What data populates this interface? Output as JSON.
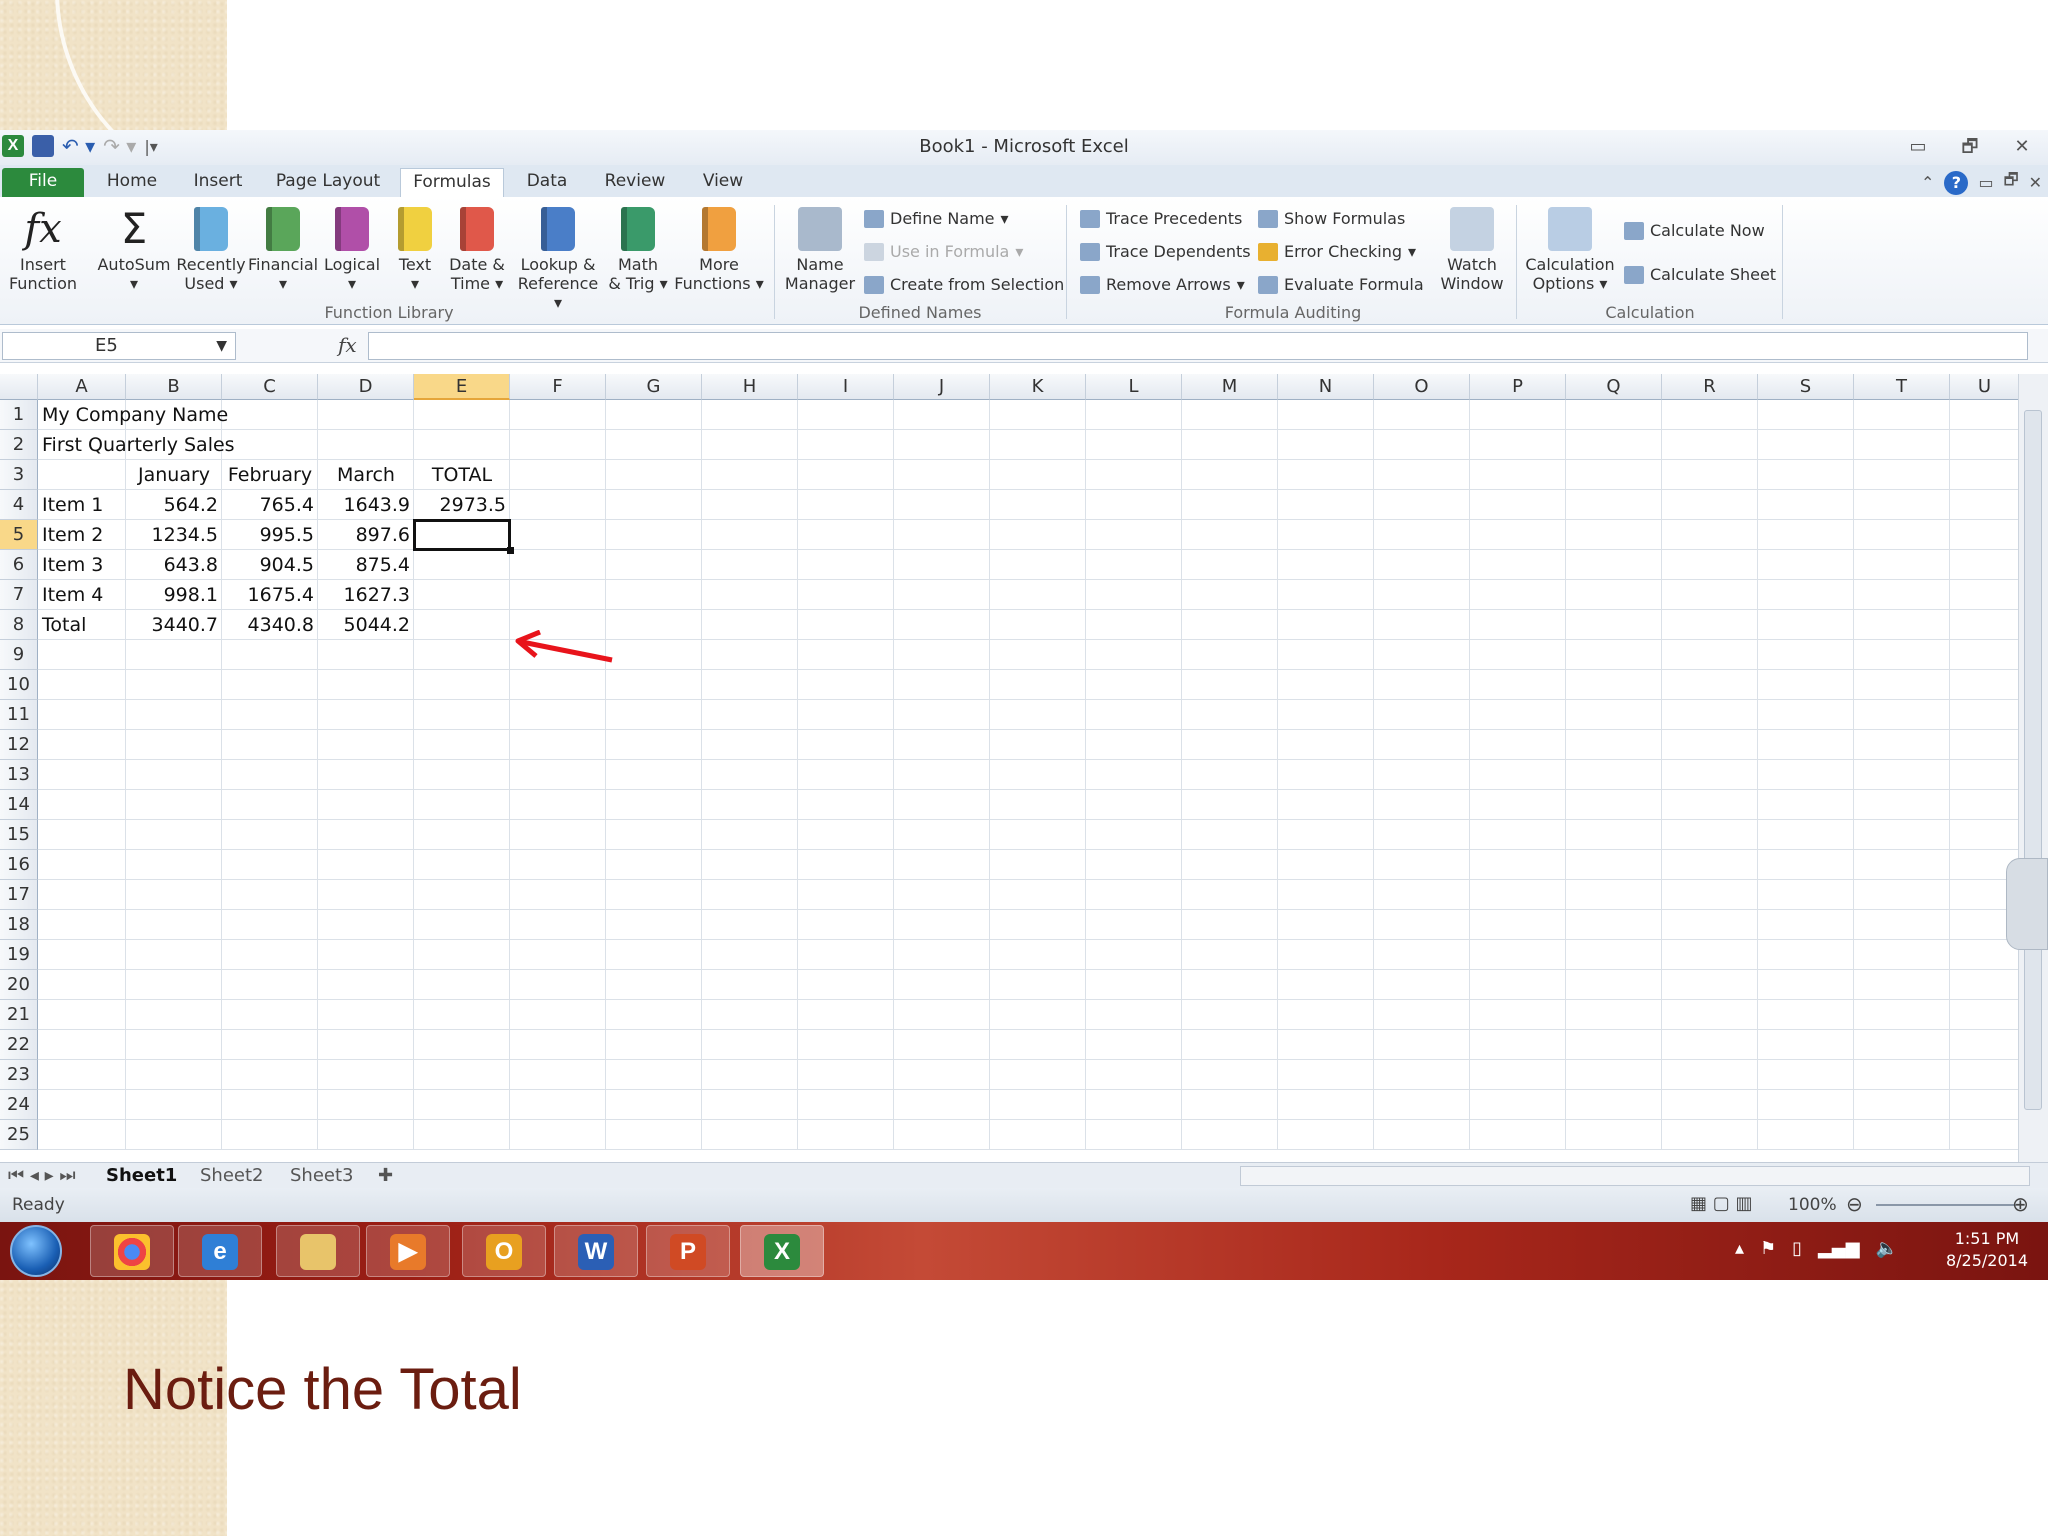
{
  "window": {
    "title": "Book1  -  Microsoft Excel",
    "min": "▭",
    "restore": "🗗",
    "close": "✕"
  },
  "tabs": [
    "File",
    "Home",
    "Insert",
    "Page Layout",
    "Formulas",
    "Data",
    "Review",
    "View"
  ],
  "active_tab": "Formulas",
  "ribbon": {
    "function_library": {
      "insert_function": [
        "Insert",
        "Function"
      ],
      "autosum": "AutoSum",
      "recently_used": [
        "Recently",
        "Used"
      ],
      "financial": "Financial",
      "logical": "Logical",
      "text": "Text",
      "date_time": [
        "Date &",
        "Time"
      ],
      "lookup": [
        "Lookup &",
        "Reference"
      ],
      "math": [
        "Math",
        "& Trig"
      ],
      "more": [
        "More",
        "Functions"
      ],
      "label": "Function Library"
    },
    "defined_names": {
      "name_manager": [
        "Name",
        "Manager"
      ],
      "define_name": "Define Name",
      "use_in_formula": "Use in Formula",
      "create_from_selection": "Create from Selection",
      "label": "Defined Names"
    },
    "formula_auditing": {
      "trace_precedents": "Trace Precedents",
      "trace_dependents": "Trace Dependents",
      "remove_arrows": "Remove Arrows",
      "show_formulas": "Show Formulas",
      "error_checking": "Error Checking",
      "evaluate_formula": "Evaluate Formula",
      "watch_window": [
        "Watch",
        "Window"
      ],
      "label": "Formula Auditing"
    },
    "calculation": {
      "options": [
        "Calculation",
        "Options"
      ],
      "calc_now": "Calculate Now",
      "calc_sheet": "Calculate Sheet",
      "label": "Calculation"
    }
  },
  "formula_bar": {
    "name_box": "E5",
    "fx": "fx",
    "formula": ""
  },
  "columns": [
    "A",
    "B",
    "C",
    "D",
    "E",
    "F",
    "G",
    "H",
    "I",
    "J",
    "K",
    "L",
    "M",
    "N",
    "O",
    "P",
    "Q",
    "R",
    "S",
    "T",
    "U"
  ],
  "selected_column": "E",
  "rows": [
    "1",
    "2",
    "3",
    "4",
    "5",
    "6",
    "7",
    "8",
    "9",
    "10",
    "11",
    "12",
    "13",
    "14",
    "15",
    "16",
    "17",
    "18",
    "19",
    "20",
    "21",
    "22",
    "23",
    "24",
    "25"
  ],
  "selected_row": "5",
  "cells": {
    "A1": "My Company Name",
    "A2": "First Quarterly Sales",
    "B3": "January",
    "C3": "February",
    "D3": "March",
    "E3": "TOTAL",
    "A4": "Item 1",
    "B4": "564.2",
    "C4": "765.4",
    "D4": "1643.9",
    "E4": "2973.5",
    "A5": "Item 2",
    "B5": "1234.5",
    "C5": "995.5",
    "D5": "897.6",
    "A6": "Item 3",
    "B6": "643.8",
    "C6": "904.5",
    "D6": "875.4",
    "A7": "Item 4",
    "B7": "998.1",
    "C7": "1675.4",
    "D7": "1627.3",
    "A8": "Total",
    "B8": "3440.7",
    "C8": "4340.8",
    "D8": "5044.2"
  },
  "sheets": [
    "Sheet1",
    "Sheet2",
    "Sheet3"
  ],
  "active_sheet": "Sheet1",
  "status": {
    "text": "Ready",
    "zoom": "100%"
  },
  "taskbar": {
    "time": "1:51 PM",
    "date": "8/25/2014"
  },
  "caption": "Notice the Total",
  "colors": {
    "excel_green": "#2c8a3d",
    "arrow_red": "#e8141b",
    "caption": "#6b1d10"
  }
}
